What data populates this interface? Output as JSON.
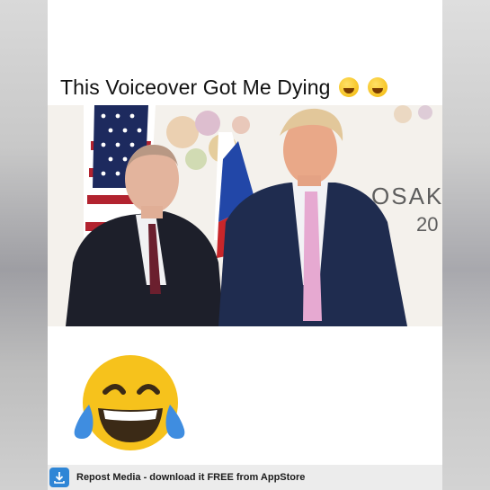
{
  "post": {
    "caption": "This Voiceover Got Me Dying",
    "caption_emojis": [
      "rolling-on-floor-laughing-emoji",
      "tears-of-joy-emoji"
    ],
    "photo_text_line1": "OSAK",
    "photo_text_line2": "20"
  },
  "footer": {
    "icon": "repost-download-icon",
    "text": "Repost Media - download it FREE from AppStore"
  },
  "colors": {
    "frame_background": "#ffffff",
    "footer_background": "#ececec",
    "repost_icon": "#2f86d6",
    "emoji_yellow": "#f6c21c"
  }
}
